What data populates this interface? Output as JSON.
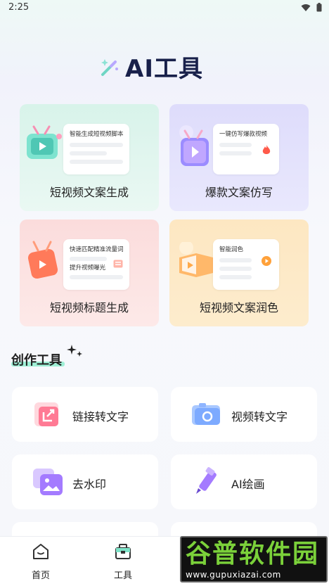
{
  "status_bar": {
    "time": "2:25"
  },
  "header": {
    "title": "AI工具"
  },
  "feature_cards": [
    {
      "label": "短视频文案生成",
      "sheet_text": [
        "智能生成短视频脚本"
      ],
      "color": "#d8f3ea"
    },
    {
      "label": "爆款文案仿写",
      "sheet_text": [
        "一键仿写爆款视频"
      ],
      "color": "#dedcfb"
    },
    {
      "label": "短视频标题生成",
      "sheet_text": [
        "快速匹配精准流量词",
        "提升视频曝光"
      ],
      "color": "#fbdcdc"
    },
    {
      "label": "短视频文案润色",
      "sheet_text": [
        "智能润色"
      ],
      "color": "#fde7c2"
    }
  ],
  "section": {
    "title": "创作工具"
  },
  "tools": [
    {
      "label": "链接转文字",
      "icon": "link-share-icon"
    },
    {
      "label": "视频转文字",
      "icon": "camera-icon"
    },
    {
      "label": "去水印",
      "icon": "image-icon"
    },
    {
      "label": "AI绘画",
      "icon": "pencil-icon"
    }
  ],
  "bottom_nav": [
    {
      "label": "首页",
      "icon": "home-icon"
    },
    {
      "label": "工具",
      "icon": "toolbox-icon"
    }
  ],
  "watermark": {
    "top": "谷普软件园",
    "bottom": "www.gupuxiazai.com"
  }
}
